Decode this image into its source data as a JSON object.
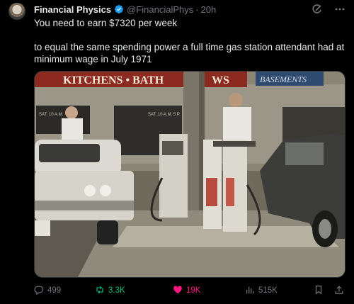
{
  "author": {
    "name": "Financial Physics",
    "handle": "@FinancialPhys",
    "separator": "·",
    "time": "20h",
    "verified_color": "#1d9bf0"
  },
  "tweet": {
    "line1": "You need to earn $7320 per week",
    "line2": "to equal the same spending power a full time gas station attendant had at minimum wage in July 1971"
  },
  "media": {
    "sign_left": "KITCHENS • BATH",
    "sign_mid": "WS",
    "sign_right": "BASEMENTS",
    "small_sign_left": "SAT. 10 A.M.",
    "small_sign_mid": "SAT. 10 A.M. 5 P."
  },
  "actions": {
    "replies": "499",
    "reposts": "3.3K",
    "likes": "19K",
    "views": "515K"
  },
  "icons": {
    "reply": "reply-icon",
    "repost": "repost-icon",
    "like": "heart-icon",
    "views": "views-icon",
    "bookmark": "bookmark-icon",
    "share": "share-icon",
    "grok": "grok-icon",
    "more": "more-icon"
  },
  "colors": {
    "background": "#000000",
    "text": "#e7e9ea",
    "muted": "#71767b",
    "repost_active": "#00ba7c",
    "like_active": "#f91880"
  }
}
